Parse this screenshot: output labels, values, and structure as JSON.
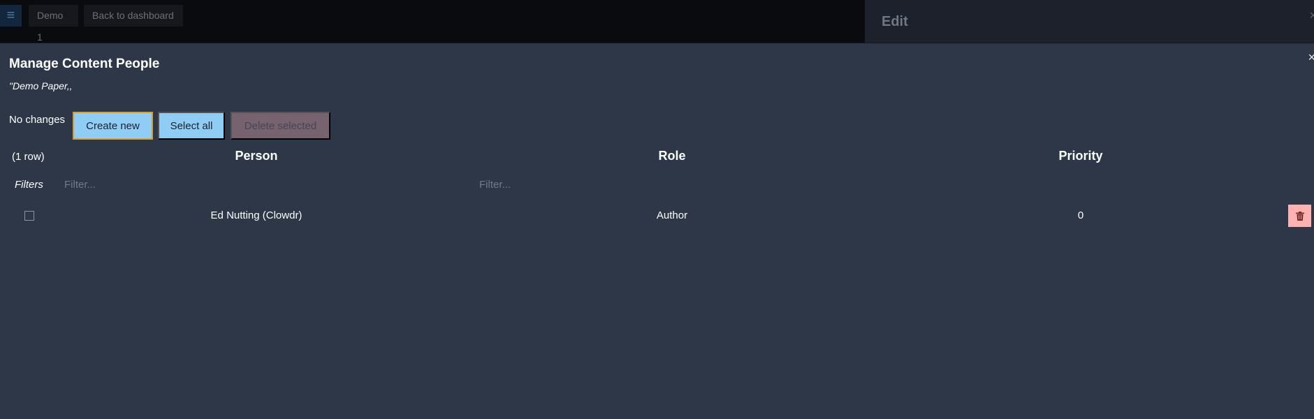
{
  "topbar": {
    "menu_glyph": "≡",
    "demo_label": "Demo 1",
    "back_label": "Back to dashboard"
  },
  "side_panel": {
    "title": "Edit",
    "close_glyph": "×"
  },
  "modal": {
    "close_glyph": "×",
    "title": "Manage Content People",
    "subtitle": "\"Demo Paper,,",
    "status": "No changes",
    "buttons": {
      "create": "Create new",
      "select_all": "Select all",
      "delete_selected": "Delete selected"
    }
  },
  "table": {
    "row_count": "(1 row)",
    "columns": [
      "Person",
      "Role",
      "Priority"
    ],
    "filters_label": "Filters",
    "filter_placeholders": [
      "Filter...",
      "Filter..."
    ],
    "rows": [
      {
        "person": "Ed Nutting (Clowdr)",
        "role": "Author",
        "priority": "0",
        "selected": false
      }
    ]
  },
  "colors": {
    "background": "#2d3748",
    "primary_button": "#90cdf4",
    "focus_border": "#d69e2e",
    "delete_button": "#feb2b2"
  },
  "icons": [
    "menu-icon",
    "close-icon",
    "checkbox-icon",
    "trash-icon"
  ]
}
